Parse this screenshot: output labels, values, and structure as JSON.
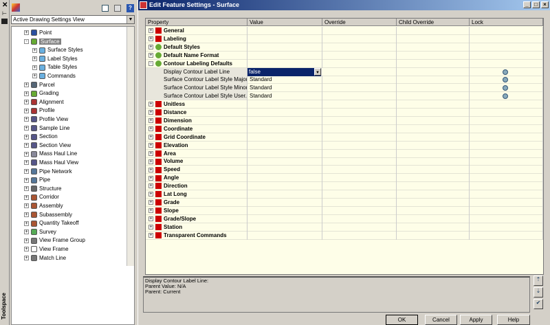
{
  "toolspace": {
    "label": "Toolspace",
    "view": "Active Drawing Settings View",
    "tree": [
      {
        "label": "Point",
        "level": 0,
        "exp": "+",
        "color": "#2a4fa0"
      },
      {
        "label": "Surface",
        "level": 0,
        "exp": "-",
        "color": "#6a3",
        "selected": true
      },
      {
        "label": "Surface Styles",
        "level": 1,
        "exp": "+",
        "color": "#6ab0e0"
      },
      {
        "label": "Label Styles",
        "level": 1,
        "exp": "+",
        "color": "#6ab0e0"
      },
      {
        "label": "Table Styles",
        "level": 1,
        "exp": "+",
        "color": "#6ab0e0"
      },
      {
        "label": "Commands",
        "level": 1,
        "exp": "+",
        "color": "#6ab0e0"
      },
      {
        "label": "Parcel",
        "level": 0,
        "exp": "+",
        "color": "#567"
      },
      {
        "label": "Grading",
        "level": 0,
        "exp": "+",
        "color": "#6a3"
      },
      {
        "label": "Alignment",
        "level": 0,
        "exp": "+",
        "color": "#a33"
      },
      {
        "label": "Profile",
        "level": 0,
        "exp": "+",
        "color": "#a33"
      },
      {
        "label": "Profile View",
        "level": 0,
        "exp": "+",
        "color": "#558"
      },
      {
        "label": "Sample Line",
        "level": 0,
        "exp": "+",
        "color": "#558"
      },
      {
        "label": "Section",
        "level": 0,
        "exp": "+",
        "color": "#558"
      },
      {
        "label": "Section View",
        "level": 0,
        "exp": "+",
        "color": "#558"
      },
      {
        "label": "Mass Haul Line",
        "level": 0,
        "exp": "+",
        "color": "#889"
      },
      {
        "label": "Mass Haul View",
        "level": 0,
        "exp": "+",
        "color": "#558"
      },
      {
        "label": "Pipe Network",
        "level": 0,
        "exp": "+",
        "color": "#579"
      },
      {
        "label": "Pipe",
        "level": 0,
        "exp": "+",
        "color": "#579"
      },
      {
        "label": "Structure",
        "level": 0,
        "exp": "+",
        "color": "#666"
      },
      {
        "label": "Corridor",
        "level": 0,
        "exp": "+",
        "color": "#a53"
      },
      {
        "label": "Assembly",
        "level": 0,
        "exp": "+",
        "color": "#a53"
      },
      {
        "label": "Subassembly",
        "level": 0,
        "exp": "+",
        "color": "#a53"
      },
      {
        "label": "Quantity Takeoff",
        "level": 0,
        "exp": "+",
        "color": "#a53"
      },
      {
        "label": "Survey",
        "level": 0,
        "exp": "+",
        "color": "#5a5"
      },
      {
        "label": "View Frame Group",
        "level": 0,
        "exp": "+",
        "color": "#777"
      },
      {
        "label": "View Frame",
        "level": 0,
        "exp": "+",
        "color": "#fff"
      },
      {
        "label": "Match Line",
        "level": 0,
        "exp": "+",
        "color": "#777"
      }
    ]
  },
  "dialog": {
    "title": "Edit Feature Settings - Surface",
    "columns": [
      "Property",
      "Value",
      "Override",
      "Child Override",
      "Lock"
    ],
    "rows": [
      {
        "name": "General",
        "group": true,
        "exp": "+",
        "icon": "#c00"
      },
      {
        "name": "Labeling",
        "group": true,
        "exp": "+",
        "icon": "#c00"
      },
      {
        "name": "Default Styles",
        "group": true,
        "exp": "+",
        "icon": "#6a3"
      },
      {
        "name": "Default Name Format",
        "group": true,
        "exp": "+",
        "icon": "#6a3"
      },
      {
        "name": "Contour Labeling Defaults",
        "group": true,
        "exp": "-",
        "icon": "#6a3"
      },
      {
        "name": "Display Contour Label Line",
        "value": "false",
        "dropdown": true,
        "lock": true
      },
      {
        "name": "Surface Contour Label Style Major",
        "value": "Standard",
        "lock": true
      },
      {
        "name": "Surface Contour Label Style Minor",
        "value": "Standard",
        "lock": true
      },
      {
        "name": "Surface Contour Label Style User...",
        "value": "Standard",
        "lock": true
      },
      {
        "name": "Unitless",
        "group": true,
        "exp": "+",
        "icon": "#c00"
      },
      {
        "name": "Distance",
        "group": true,
        "exp": "+",
        "icon": "#c00"
      },
      {
        "name": "Dimension",
        "group": true,
        "exp": "+",
        "icon": "#c00"
      },
      {
        "name": "Coordinate",
        "group": true,
        "exp": "+",
        "icon": "#c00"
      },
      {
        "name": "Grid Coordinate",
        "group": true,
        "exp": "+",
        "icon": "#c00"
      },
      {
        "name": "Elevation",
        "group": true,
        "exp": "+",
        "icon": "#c00"
      },
      {
        "name": "Area",
        "group": true,
        "exp": "+",
        "icon": "#c00"
      },
      {
        "name": "Volume",
        "group": true,
        "exp": "+",
        "icon": "#c00"
      },
      {
        "name": "Speed",
        "group": true,
        "exp": "+",
        "icon": "#c00"
      },
      {
        "name": "Angle",
        "group": true,
        "exp": "+",
        "icon": "#c00"
      },
      {
        "name": "Direction",
        "group": true,
        "exp": "+",
        "icon": "#c00"
      },
      {
        "name": "Lat Long",
        "group": true,
        "exp": "+",
        "icon": "#c00"
      },
      {
        "name": "Grade",
        "group": true,
        "exp": "+",
        "icon": "#c00"
      },
      {
        "name": "Slope",
        "group": true,
        "exp": "+",
        "icon": "#c00"
      },
      {
        "name": "Grade/Slope",
        "group": true,
        "exp": "+",
        "icon": "#c00"
      },
      {
        "name": "Station",
        "group": true,
        "exp": "+",
        "icon": "#c00"
      },
      {
        "name": "Transparent Commands",
        "group": true,
        "exp": "+",
        "icon": "#c00"
      }
    ],
    "description": [
      "Display Contour Label Line:",
      "Parent Value: N/A",
      "Parent: Current"
    ],
    "buttons": {
      "ok": "OK",
      "cancel": "Cancel",
      "apply": "Apply",
      "help": "Help"
    }
  }
}
